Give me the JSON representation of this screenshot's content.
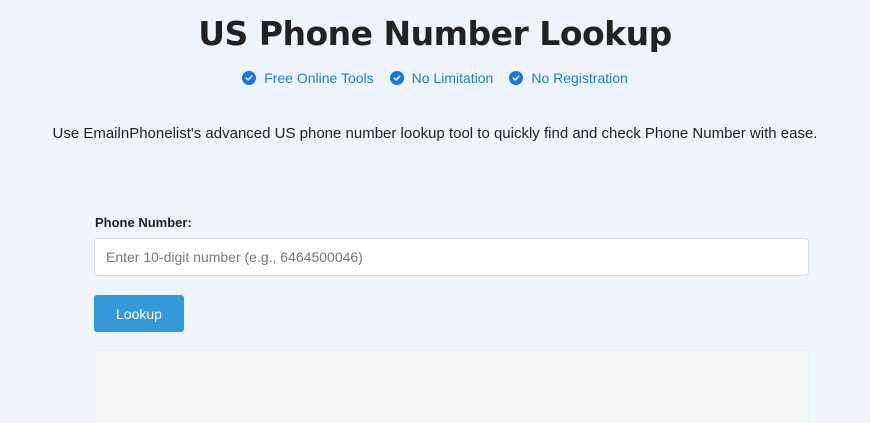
{
  "header": {
    "title": "US Phone Number Lookup",
    "features": [
      {
        "label": "Free Online Tools",
        "icon": "check-circle-icon"
      },
      {
        "label": "No Limitation",
        "icon": "check-circle-icon"
      },
      {
        "label": "No Registration",
        "icon": "check-circle-icon"
      }
    ],
    "description": "Use EmailnPhonelist's advanced US phone number lookup tool to quickly find and check Phone Number with ease."
  },
  "form": {
    "phone_label": "Phone Number:",
    "phone_value": "",
    "phone_placeholder": "Enter 10-digit number (e.g., 6464500046)",
    "lookup_label": "Lookup"
  },
  "colors": {
    "background": "#eef5fd",
    "accent": "#1e7fd8",
    "button": "#3498db"
  }
}
